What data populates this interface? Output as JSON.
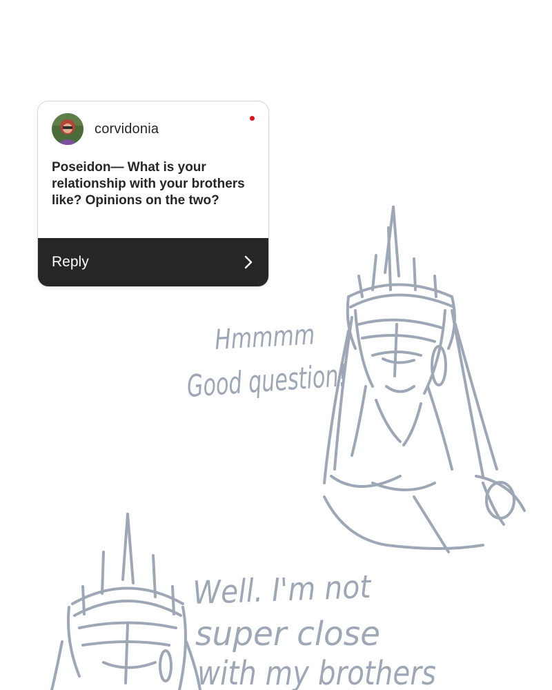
{
  "question_card": {
    "username": "corvidonia",
    "question": "Poseidon— What is your relationship with your brothers like? Opinions on the two?",
    "reply_label": "Reply",
    "unread_dot_color": "#e0151c",
    "reply_bar_color": "#262626"
  },
  "sketch": {
    "stroke_color": "#98a3b3",
    "speech_1": [
      "Hmmmm",
      "Good question!"
    ],
    "speech_2": [
      "Well. I'm not",
      "super close",
      "with my brothers"
    ]
  },
  "icons": {
    "avatar": "avatar-image",
    "reply_arrow": "chevron-right-icon"
  }
}
